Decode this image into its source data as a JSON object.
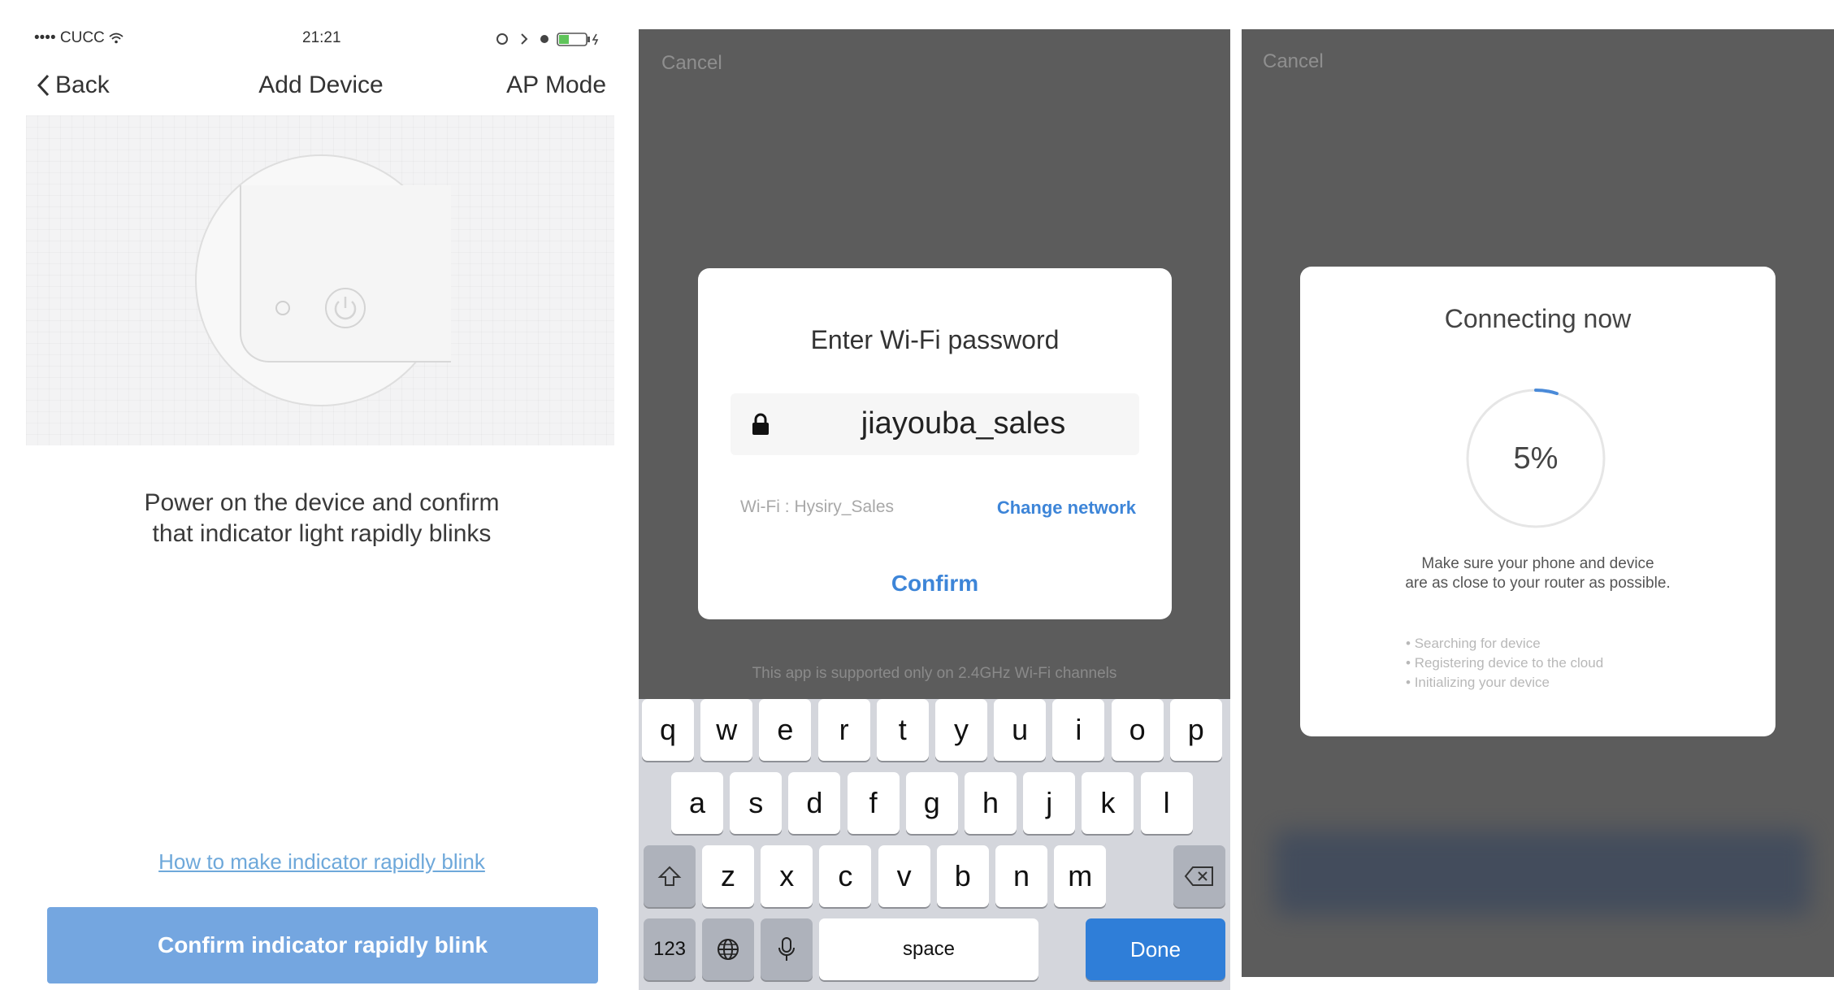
{
  "panel1": {
    "status": {
      "carrier": "•••• CUCC",
      "time": "21:21"
    },
    "nav": {
      "back_label": "Back",
      "title": "Add Device",
      "right_label": "AP Mode"
    },
    "message_line1": "Power on the device and confirm",
    "message_line2": "that indicator light rapidly blinks",
    "help_link": "How to make indicator rapidly blink",
    "confirm_button": "Confirm indicator rapidly blink",
    "colors": {
      "button": "#74a6e0",
      "link": "#6ea8da"
    }
  },
  "panel2": {
    "cancel_label": "Cancel",
    "dialog": {
      "title": "Enter Wi-Fi password",
      "password_value": "jiayouba_sales",
      "wifi_label": "Wi-Fi : Hysiry_Sales",
      "change_network_label": "Change network",
      "confirm_label": "Confirm"
    },
    "note": "This app is supported only on 2.4GHz Wi-Fi channels",
    "keyboard": {
      "row1": [
        "q",
        "w",
        "e",
        "r",
        "t",
        "y",
        "u",
        "i",
        "o",
        "p"
      ],
      "row2": [
        "a",
        "s",
        "d",
        "f",
        "g",
        "h",
        "j",
        "k",
        "l"
      ],
      "row3": [
        "z",
        "x",
        "c",
        "v",
        "b",
        "n",
        "m"
      ],
      "numbers_label": "123",
      "space_label": "space",
      "done_label": "Done"
    },
    "colors": {
      "accent": "#3d85d8",
      "done_key": "#2f7ed8"
    }
  },
  "panel3": {
    "cancel_label": "Cancel",
    "title": "Connecting now",
    "progress": 5,
    "progress_label": "5%",
    "tip_line1": "Make sure your phone and device",
    "tip_line2": "are as close to your router as possible.",
    "steps": [
      "Searching for device",
      "Registering device to the cloud",
      "Initializing your device"
    ]
  }
}
